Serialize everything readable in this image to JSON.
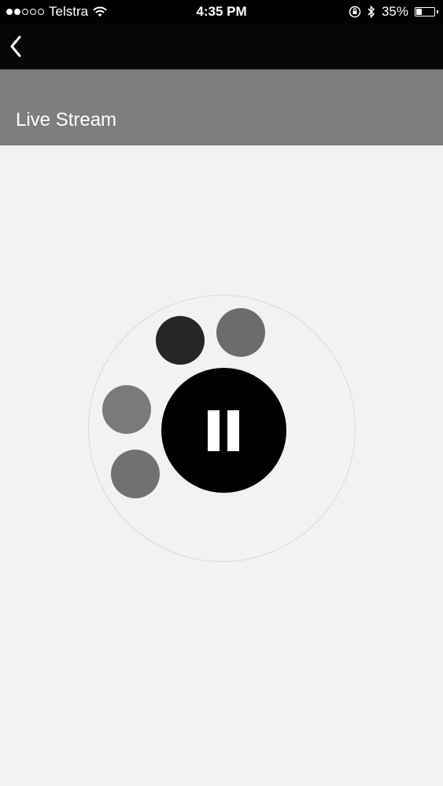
{
  "status_bar": {
    "signal_filled": 2,
    "signal_total": 5,
    "carrier": "Telstra",
    "time": "4:35 PM",
    "battery_percent_label": "35%",
    "battery_level": 0.35,
    "icons": [
      "wifi-icon",
      "orientation-lock-icon",
      "bluetooth-icon",
      "battery-icon"
    ]
  },
  "nav": {
    "back_icon": "chevron-left-icon"
  },
  "header": {
    "title": "Live Stream"
  },
  "player": {
    "control_icon": "pause-icon",
    "bubbles": [
      {
        "name": "stream-bubble-1",
        "color": "#262527"
      },
      {
        "name": "stream-bubble-2",
        "color": "#6c6b6d"
      },
      {
        "name": "stream-bubble-3",
        "color": "#7a797b"
      },
      {
        "name": "stream-bubble-4",
        "color": "#717072"
      }
    ]
  },
  "colors": {
    "status_bar_bg": "#000000",
    "nav_bg": "#060606",
    "title_bar_bg": "#7e7d80",
    "content_bg": "#f2f1f3",
    "pause_button_bg": "#000000"
  }
}
